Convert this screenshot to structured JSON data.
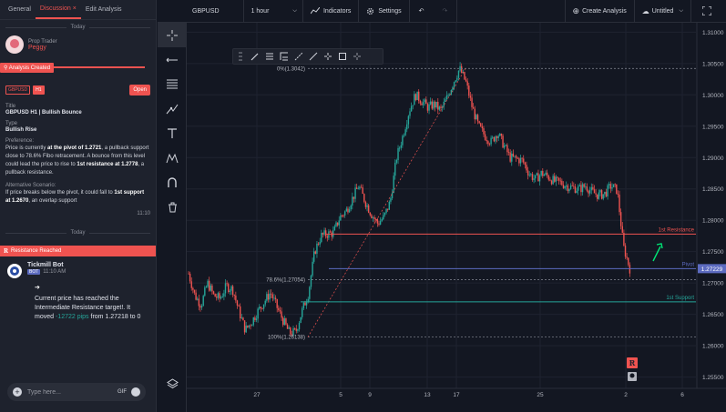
{
  "tabs": [
    {
      "label": "General",
      "active": false
    },
    {
      "label": "Discussion",
      "active": true
    },
    {
      "label": "Edit Analysis",
      "active": false
    }
  ],
  "discussion": {
    "day_label_1": "Today",
    "trader_role": "Prop Trader",
    "trader_name": "Peggy",
    "created_label": "Analysis Created",
    "symbol_badge": "GBPUSD",
    "tf_badge": "H1",
    "open_label": "Open",
    "title_key": "Title",
    "title_value": "GBPUSD H1 | Bullish Bounce",
    "type_key": "Type",
    "type_value": "Bullish Rise",
    "pref_key": "Preference:",
    "pref_parts": [
      "Price is currently ",
      "at the pivot of 1.2721",
      ", a pullback support close to 78.6% Fibo retracement. A bounce from this level could lead the price to rise to ",
      "1st resistance at 1.2778",
      ", a pullback resistance."
    ],
    "alt_key": "Alternative Scenario:",
    "alt_parts": [
      "If price breaks below the pivot, it could fall to ",
      "1st support at 1.2670",
      ", an overlap support"
    ],
    "time1": "11:10",
    "day_label_2": "Today",
    "res_icon": "R",
    "res_label": "Resistance Reached",
    "bot_name": "Tickmill Bot",
    "bot_tag": "BOT",
    "bot_time": "11:10 AM",
    "bot_msg_1": "Current price has reached the Intermediate Resistance target!. It moved ",
    "bot_msg_pips": "-12722 pips",
    "bot_msg_2": " from 1.27218 to 0",
    "input_placeholder": "Type here...",
    "gif_label": "GIF"
  },
  "toolbar": {
    "symbol": "GBPUSD",
    "interval": "1 hour",
    "indicators": "Indicators",
    "settings": "Settings",
    "create_analysis": "Create Analysis",
    "layout_name": "Untitled"
  },
  "chart_data": {
    "type": "candlestick",
    "symbol": "GBPUSD",
    "x_tick_labels": [
      "27",
      "5",
      "9",
      "13",
      "17",
      "25",
      "2",
      "6"
    ],
    "y_ticks": [
      1.31,
      1.305,
      1.3,
      1.295,
      1.29,
      1.285,
      1.28,
      1.275,
      1.27,
      1.265,
      1.26,
      1.255
    ],
    "y_tick_labels": [
      "1.31000",
      "1.30500",
      "1.30000",
      "1.29500",
      "1.29000",
      "1.28500",
      "1.28000",
      "1.27500",
      "1.27000",
      "1.26500",
      "1.26000",
      "1.25500"
    ],
    "ylim": [
      1.2532,
      1.3115
    ],
    "current_price": 1.27229,
    "current_price_label": "1.27229",
    "price_path": [
      1.2715,
      1.268,
      1.2665,
      1.27,
      1.268,
      1.2675,
      1.2695,
      1.269,
      1.2655,
      1.2625,
      1.2638,
      1.2655,
      1.267,
      1.2685,
      1.2662,
      1.264,
      1.262,
      1.2622,
      1.2655,
      1.2683,
      1.275,
      1.2775,
      1.2778,
      1.278,
      1.2805,
      1.2815,
      1.2835,
      1.2855,
      1.283,
      1.281,
      1.2795,
      1.2805,
      1.283,
      1.29,
      1.2935,
      1.2975,
      1.3,
      1.299,
      1.298,
      1.2985,
      1.2975,
      1.2995,
      1.302,
      1.3042,
      1.302,
      1.298,
      1.295,
      1.2935,
      1.2925,
      1.294,
      1.292,
      1.29,
      1.2898,
      1.2895,
      1.2875,
      1.2865,
      1.2875,
      1.287,
      1.2862,
      1.286,
      1.2855,
      1.2852,
      1.285,
      1.2855,
      1.2845,
      1.284,
      1.2842,
      1.2855,
      1.2848,
      1.2758,
      1.2723
    ],
    "levels": [
      {
        "name": "1st Resistance",
        "value": 1.2778,
        "color": "#ef5350"
      },
      {
        "name": "Pivot",
        "value": 1.27229,
        "color": "#5c6bc0"
      },
      {
        "name": "1st Support",
        "value": 1.267,
        "color": "#26a69a"
      }
    ],
    "fib_levels": [
      {
        "label": "0%(1.3042)",
        "value": 1.3042
      },
      {
        "label": "78.6%(1.27054)",
        "value": 1.27054
      },
      {
        "label": "100%(1.26138)",
        "value": 1.26138
      }
    ],
    "up_color": "#26a69a",
    "down_color": "#ef5350",
    "marker_label": "R"
  },
  "colors": {
    "accent": "#ef5350",
    "bg": "#131722",
    "panel": "#1e222d"
  }
}
